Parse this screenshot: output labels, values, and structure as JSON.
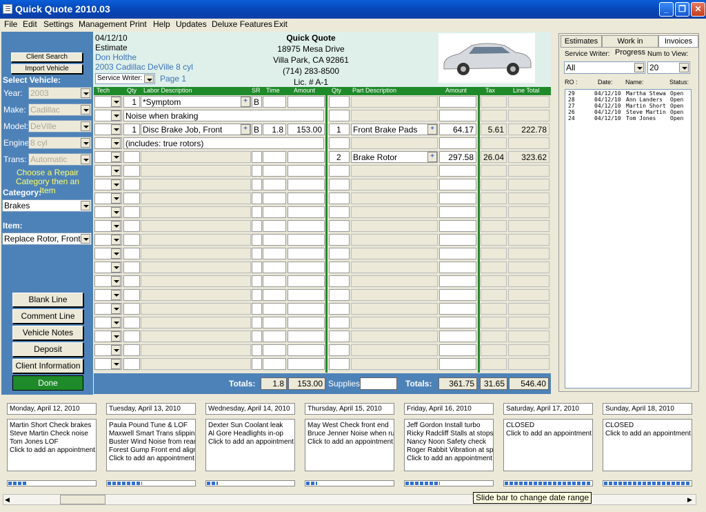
{
  "window": {
    "title": "Quick Quote 2010.03"
  },
  "menu": [
    "File",
    "Edit",
    "Settings",
    "Management",
    "Print",
    "Help",
    "Updates",
    "Deluxe Features",
    "Exit"
  ],
  "left": {
    "client_search": "Client Search",
    "import_vehicle": "Import Vehicle",
    "select_vehicle": "Select Vehicle:",
    "fields": [
      {
        "label": "Year:",
        "value": "2003"
      },
      {
        "label": "Make:",
        "value": "Cadillac"
      },
      {
        "label": "Model:",
        "value": "DeVille"
      },
      {
        "label": "Engine",
        "value": "8 cyl"
      },
      {
        "label": "Trans:",
        "value": "Automatic"
      }
    ],
    "hint": "Choose a Repair Category then an Item",
    "category_label": "Category:",
    "category_value": "Brakes",
    "item_label": "Item:",
    "item_value": "Replace Rotor, Front",
    "buttons": [
      "Blank Line",
      "Comment Line",
      "Vehicle Notes",
      "Deposit",
      "Client Information"
    ],
    "done": "Done"
  },
  "header": {
    "date": "04/12/10",
    "type": "Estimate",
    "client": "Don Holthe",
    "vehicle": "2003 Cadillac DeVille 8 cyl",
    "service_writer_label": "Service Writer:",
    "page": "Page 1",
    "shop_name": "Quick Quote",
    "address1": "18975 Mesa Drive",
    "address2": "Villa Park, CA 92861",
    "phone": "(714) 283-8500",
    "license": "Lic. # A-1"
  },
  "grid": {
    "columns": [
      "Tech",
      "Qty",
      "Labor Description",
      "SR",
      "Time",
      "Amount",
      "Qty",
      "Part Description",
      "Amount",
      "Tax",
      "Line Total"
    ],
    "rows": [
      {
        "qty": "1",
        "desc": "*Symptom",
        "sr": "B",
        "time": "",
        "amount": "",
        "pqty": "",
        "pdesc": "",
        "pamount": "",
        "tax": "",
        "total": "",
        "plus": true
      },
      {
        "comment": "Noise when braking"
      },
      {
        "qty": "1",
        "desc": "Disc Brake Job, Front",
        "sr": "B",
        "time": "1.8",
        "amount": "153.00",
        "pqty": "1",
        "pdesc": "Front Brake Pads",
        "pamount": "64.17",
        "tax": "5.61",
        "total": "222.78",
        "plus": true,
        "pplus": true
      },
      {
        "comment": "(includes: true rotors)"
      },
      {
        "qty": "",
        "desc": "",
        "sr": "",
        "time": "",
        "amount": "",
        "pqty": "2",
        "pdesc": "Brake Rotor",
        "pamount": "297.58",
        "tax": "26.04",
        "total": "323.62",
        "pplus": true
      }
    ],
    "total_rows": 20
  },
  "totals": {
    "label": "Totals:",
    "time": "1.8",
    "labor": "153.00",
    "supplies_label": "Supplies:",
    "label2": "Totals:",
    "parts": "361.75",
    "tax": "31.65",
    "grand": "546.40"
  },
  "right": {
    "tabs": [
      "Estimates",
      "Work in Progress",
      "Invoices"
    ],
    "service_writer_label": "Service Writer:",
    "num_label": "Num to View:",
    "service_writer_value": "All",
    "num_value": "20",
    "cols": [
      "RO :",
      "Date:",
      "Name:",
      "Status:"
    ],
    "invoices": [
      {
        "ro": "29",
        "date": "04/12/10",
        "name": "Martha Stewa",
        "status": "Open"
      },
      {
        "ro": "28",
        "date": "04/12/10",
        "name": "Ann Landers",
        "status": "Open"
      },
      {
        "ro": "27",
        "date": "04/12/10",
        "name": "Martin Short",
        "status": "Open"
      },
      {
        "ro": "26",
        "date": "04/12/10",
        "name": "Steve Martin",
        "status": "Open"
      },
      {
        "ro": "24",
        "date": "04/12/10",
        "name": "Tom Jones",
        "status": "Open"
      }
    ]
  },
  "calendar": [
    {
      "day": "Monday, April 12, 2010",
      "lines": [
        "Martin Short Check brakes",
        "Steve Martin Check noise",
        "Tom Jones LOF",
        "Click to add an appointment."
      ],
      "progress": 0.22
    },
    {
      "day": "Tuesday, April 13, 2010",
      "lines": [
        "Paula Pound Tune & LOF",
        "Maxwell Smart Trans slipping",
        "Buster Wind Noise from rear er",
        "Forest Gump Front end align",
        "Click to add an appointment."
      ],
      "progress": 0.4
    },
    {
      "day": "Wednesday, April 14, 2010",
      "lines": [
        "Dexter Sun Coolant leak",
        "Al Gore Headlights in-op",
        "Click to add an appointment."
      ],
      "progress": 0.13
    },
    {
      "day": "Thursday, April 15, 2010",
      "lines": [
        "May West Check front end",
        "Bruce Jenner Noise when runn",
        "Click to add an appointment."
      ],
      "progress": 0.13
    },
    {
      "day": "Friday, April 16, 2010",
      "lines": [
        "Jeff Gordon Install turbo",
        "Ricky Radcliff Stalls at stops",
        "Nancy Noon Safety check",
        "Roger Rabbit Vibration at spee",
        "Click to add an appointment."
      ],
      "progress": 0.4
    },
    {
      "day": "Saturday, April 17, 2010",
      "lines": [
        "CLOSED",
        "Click to add an appointment."
      ],
      "progress": 1.0
    },
    {
      "day": "Sunday, April 18, 2010",
      "lines": [
        "CLOSED",
        "Click to add an appointment."
      ],
      "progress": 1.0
    }
  ],
  "tooltip": "Slide bar to change date range"
}
